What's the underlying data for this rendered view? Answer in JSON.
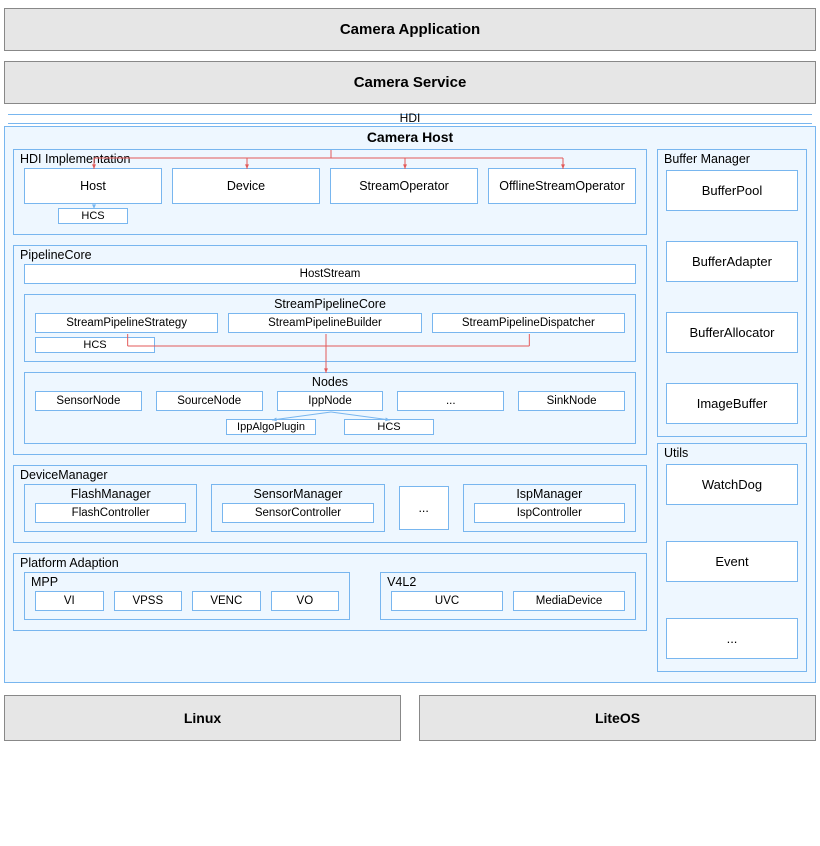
{
  "top": {
    "app": "Camera Application",
    "service": "Camera Service",
    "hdi": "HDI"
  },
  "camera_host_title": "Camera Host",
  "hdi_impl": {
    "label": "HDI Implementation",
    "items": [
      "Host",
      "Device",
      "StreamOperator",
      "OfflineStreamOperator"
    ],
    "hcs": "HCS"
  },
  "pipeline": {
    "label": "PipelineCore",
    "host_stream": "HostStream",
    "stream_core": {
      "label": "StreamPipelineCore",
      "strategy": "StreamPipelineStrategy",
      "builder": "StreamPipelineBuilder",
      "dispatcher": "StreamPipelineDispatcher",
      "hcs": "HCS"
    },
    "nodes": {
      "label": "Nodes",
      "sensor": "SensorNode",
      "source": "SourceNode",
      "ipp": "IppNode",
      "dots": "...",
      "sink": "SinkNode",
      "ipp_plugin": "IppAlgoPlugin",
      "hcs": "HCS"
    }
  },
  "device_mgr": {
    "label": "DeviceManager",
    "flash": {
      "name": "FlashManager",
      "ctrl": "FlashController"
    },
    "sensor": {
      "name": "SensorManager",
      "ctrl": "SensorController"
    },
    "dots": "...",
    "isp": {
      "name": "IspManager",
      "ctrl": "IspController"
    }
  },
  "platform": {
    "label": "Platform Adaption",
    "mpp": {
      "label": "MPP",
      "items": [
        "VI",
        "VPSS",
        "VENC",
        "VO"
      ]
    },
    "v4l2": {
      "label": "V4L2",
      "items": [
        "UVC",
        "MediaDevice"
      ]
    }
  },
  "buffer_mgr": {
    "label": "Buffer Manager",
    "items": [
      "BufferPool",
      "BufferAdapter",
      "BufferAllocator",
      "ImageBuffer"
    ]
  },
  "utils": {
    "label": "Utils",
    "items": [
      "WatchDog",
      "Event",
      "..."
    ]
  },
  "os": {
    "linux": "Linux",
    "liteos": "LiteOS"
  },
  "colors": {
    "line_red": "#e35a5a",
    "line_blue": "#78b6ef"
  }
}
